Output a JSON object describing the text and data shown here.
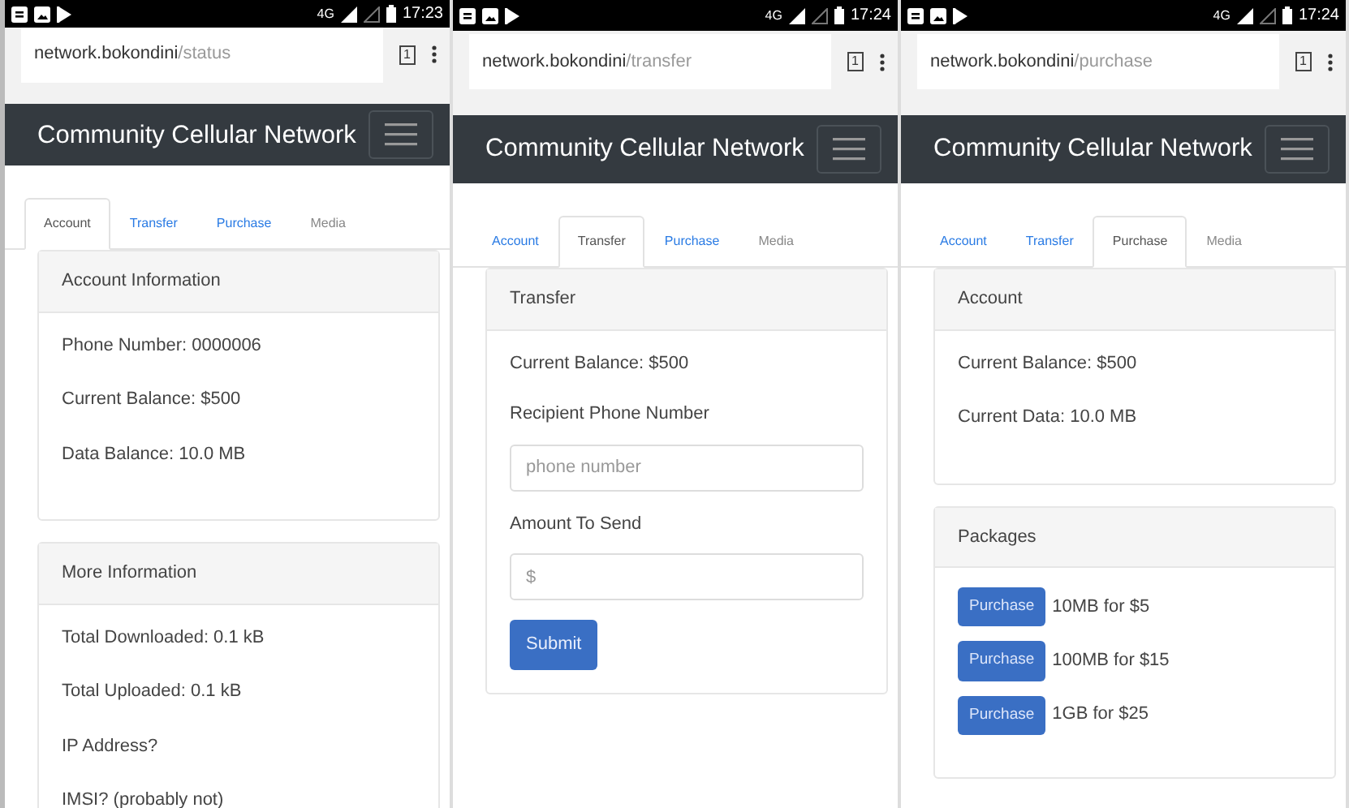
{
  "screens": [
    {
      "status_bar": {
        "network": "4G",
        "time": "17:23"
      },
      "address_bar": {
        "host": "network.bokondini",
        "path": "/status",
        "tab_count": "1"
      },
      "navbar": {
        "brand": "Community Cellular Network"
      },
      "tabs": [
        {
          "label": "Account",
          "selected": true
        },
        {
          "label": "Transfer",
          "selected": false
        },
        {
          "label": "Purchase",
          "selected": false
        },
        {
          "label": "Media",
          "selected": false
        }
      ],
      "cards": [
        {
          "kind": "info",
          "title": "Account Information",
          "lines": [
            "Phone Number: 0000006",
            "Current Balance: $500",
            "Data Balance: 10.0 MB"
          ]
        },
        {
          "kind": "info",
          "title": "More Information",
          "lines": [
            "Total Downloaded: 0.1 kB",
            "Total Uploaded: 0.1 kB",
            "IP Address?",
            "IMSI? (probably not)"
          ]
        }
      ]
    },
    {
      "status_bar": {
        "network": "4G",
        "time": "17:24"
      },
      "address_bar": {
        "host": "network.bokondini",
        "path": "/transfer",
        "tab_count": "1"
      },
      "navbar": {
        "brand": "Community Cellular Network"
      },
      "tabs": [
        {
          "label": "Account",
          "selected": false
        },
        {
          "label": "Transfer",
          "selected": true
        },
        {
          "label": "Purchase",
          "selected": false
        },
        {
          "label": "Media",
          "selected": false
        }
      ],
      "cards": [
        {
          "kind": "form",
          "title": "Transfer",
          "lines": [
            "Current Balance: $500"
          ],
          "fields": [
            {
              "label": "Recipient Phone Number",
              "placeholder": "phone number"
            },
            {
              "label": "Amount To Send",
              "placeholder": "$"
            }
          ],
          "button": "Submit"
        }
      ]
    },
    {
      "status_bar": {
        "network": "4G",
        "time": "17:24"
      },
      "address_bar": {
        "host": "network.bokondini",
        "path": "/purchase",
        "tab_count": "1"
      },
      "navbar": {
        "brand": "Community Cellular Network"
      },
      "tabs": [
        {
          "label": "Account",
          "selected": false
        },
        {
          "label": "Transfer",
          "selected": false
        },
        {
          "label": "Purchase",
          "selected": true
        },
        {
          "label": "Media",
          "selected": false
        }
      ],
      "cards": [
        {
          "kind": "info",
          "title": "Account",
          "lines": [
            "Current Balance: $500",
            "Current Data: 10.0 MB"
          ]
        },
        {
          "kind": "packages",
          "title": "Packages",
          "items": [
            {
              "button": "Purchase",
              "label": "10MB for $5"
            },
            {
              "button": "Purchase",
              "label": "100MB for $15"
            },
            {
              "button": "Purchase",
              "label": "1GB for $25"
            }
          ]
        }
      ]
    }
  ]
}
